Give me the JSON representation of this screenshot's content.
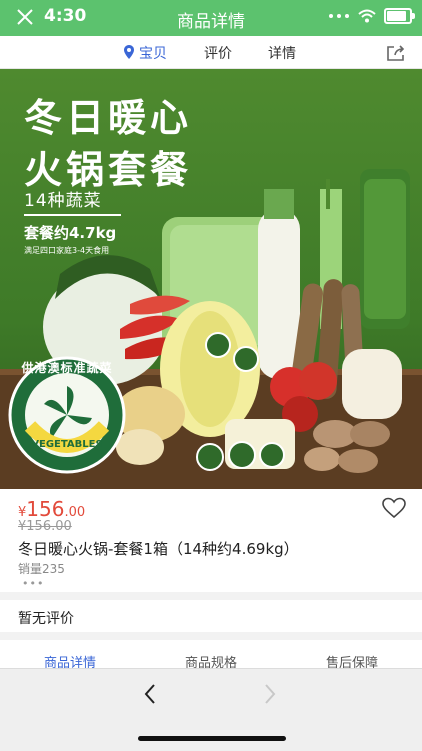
{
  "status_bar": {
    "time": "4:30",
    "title": "商品详情",
    "battery_level": 0.85
  },
  "nav": {
    "tabs": [
      {
        "label": "宝贝",
        "active": true
      },
      {
        "label": "评价",
        "active": false
      },
      {
        "label": "详情",
        "active": false
      }
    ]
  },
  "hero": {
    "line1": "冬日暖心",
    "line2": "火锅套餐",
    "tagline": "14种蔬菜",
    "weight": "套餐约4.7kg",
    "note": "满足四口家庭3-4天食用",
    "badge_text": "供港澳标准蔬菜",
    "badge_sub": "VEGETABLES"
  },
  "product": {
    "currency": "¥",
    "price_int": "156",
    "price_dec": ".00",
    "original_price": "¥156.00",
    "name": "冬日暖心火锅-套餐1箱（14种约4.69kg）",
    "sold": "销量235",
    "more": "•••"
  },
  "review": {
    "empty_text": "暂无评价"
  },
  "detail_tabs": [
    {
      "label": "商品详情",
      "active": true
    },
    {
      "label": "商品规格",
      "active": false
    },
    {
      "label": "售后保障",
      "active": false
    }
  ],
  "colors": {
    "status_green": "#5cc26e",
    "accent_blue": "#3a66d6",
    "price_red": "#e24a3b",
    "hero_green": "#4f8a2f"
  }
}
